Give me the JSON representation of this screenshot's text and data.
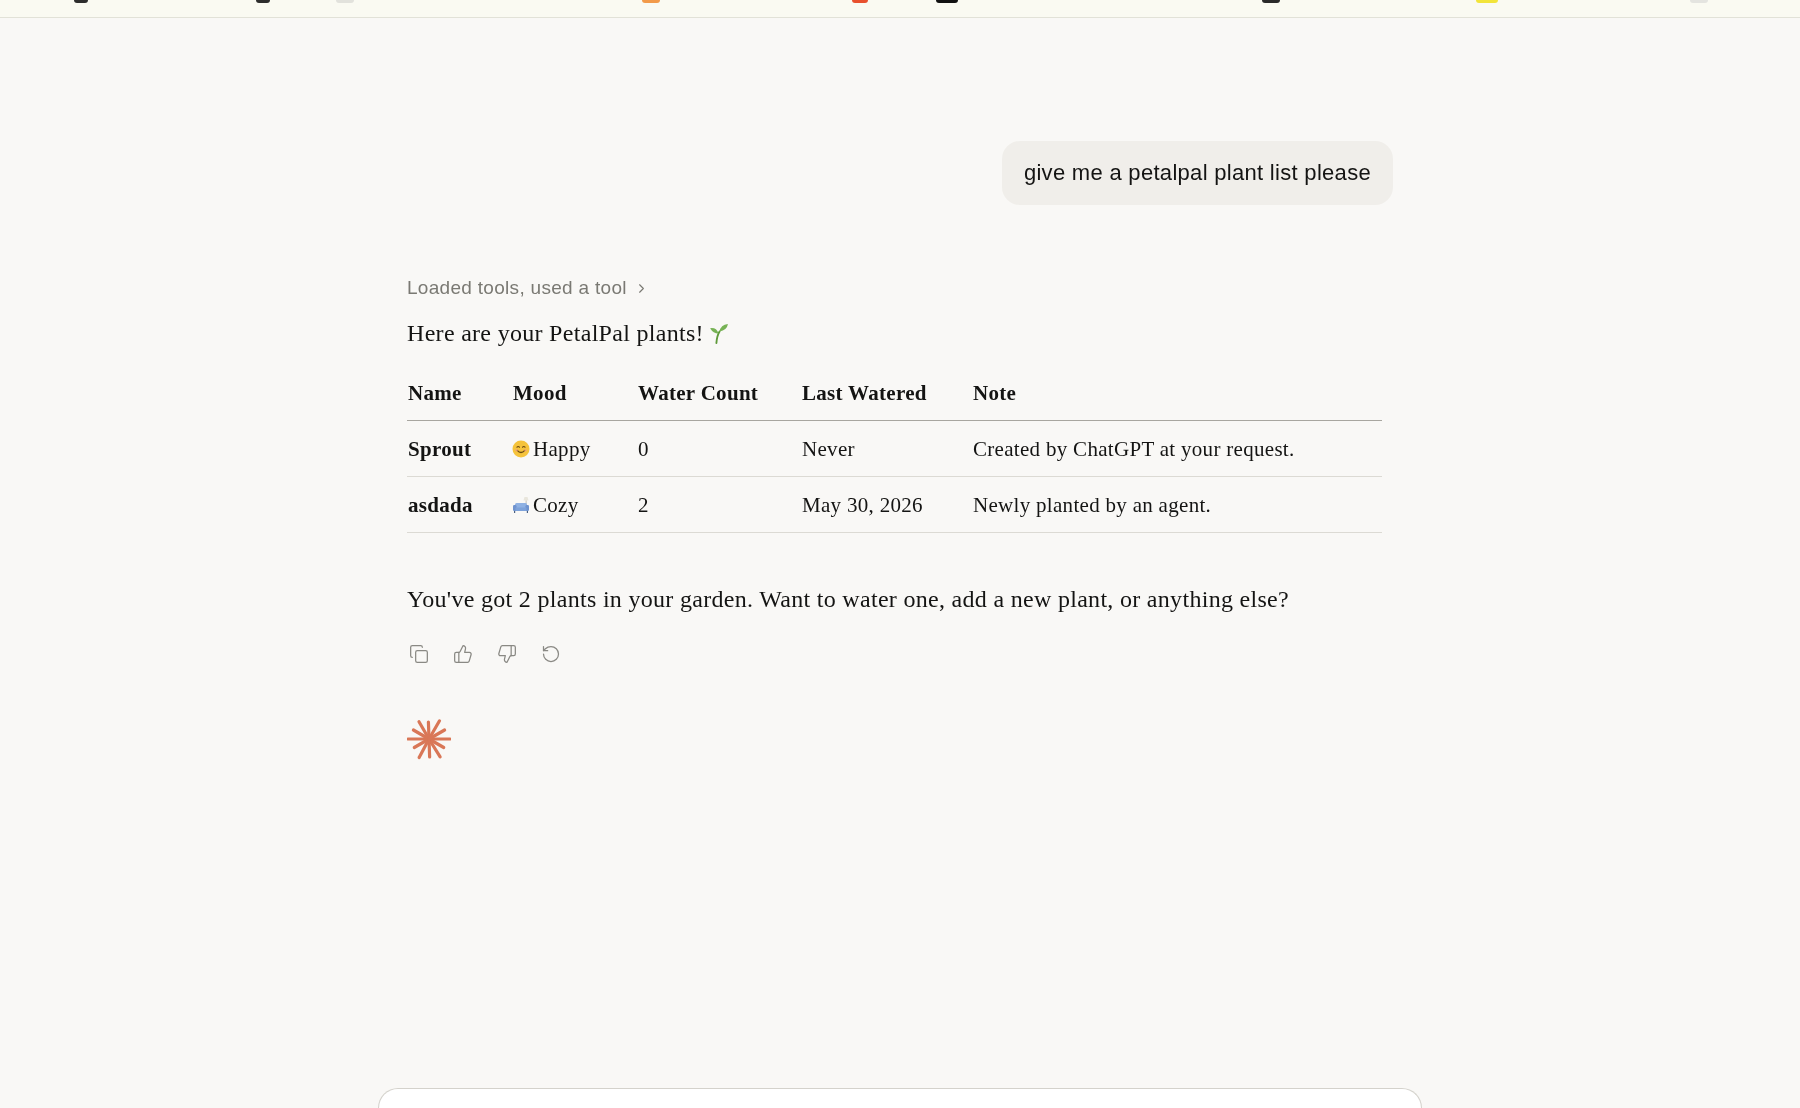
{
  "top_bar": {
    "icons": [
      {
        "color": "#2d2d2d"
      },
      {
        "color": "#2d2d2d"
      },
      {
        "color": "#e2e2dc"
      },
      {
        "color": "#f29a4a"
      },
      {
        "color": "#e8502e"
      },
      {
        "color": "#111111"
      },
      {
        "color": "#2a2a2a"
      },
      {
        "color": "#f2e43a"
      },
      {
        "color": "#e4e4e0"
      }
    ]
  },
  "conversation": {
    "user_message": "give me a petalpal plant list please",
    "tool_summary": "Loaded tools, used a tool",
    "intro": "Here are your PetalPal plants!",
    "table": {
      "columns": [
        "Name",
        "Mood",
        "Water Count",
        "Last Watered",
        "Note"
      ],
      "rows": [
        {
          "name": "Sprout",
          "mood": {
            "kind": "smiley",
            "label": "Happy"
          },
          "water_count": "0",
          "last_watered": "Never",
          "note": "Created by ChatGPT at your request."
        },
        {
          "name": "asdada",
          "mood": {
            "kind": "couch",
            "label": "Cozy"
          },
          "water_count": "2",
          "last_watered": "May 30, 2026",
          "note": "Newly planted by an agent."
        }
      ]
    },
    "closing": "You've got 2 plants in your garden. Want to water one, add a new plant, or anything else?"
  }
}
